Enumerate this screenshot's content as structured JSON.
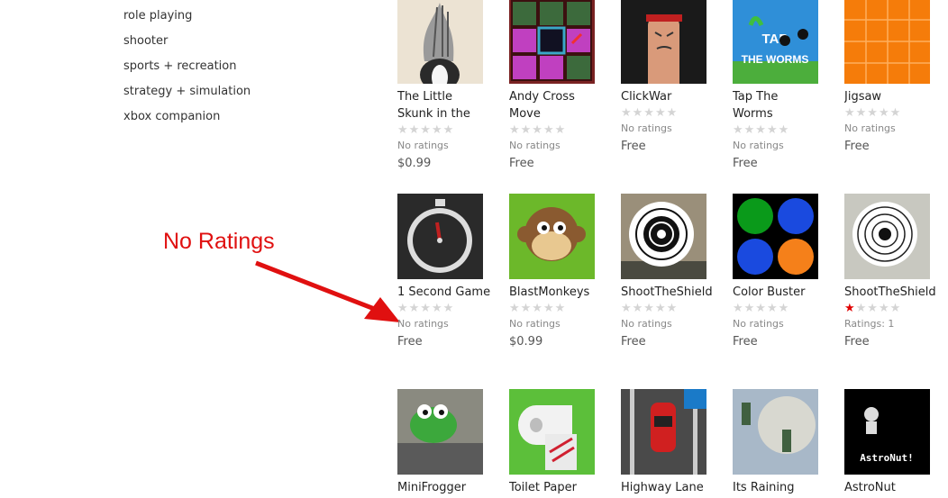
{
  "sidebar": {
    "items": [
      {
        "label": "role playing"
      },
      {
        "label": "shooter"
      },
      {
        "label": "sports + recreation"
      },
      {
        "label": "strategy + simulation"
      },
      {
        "label": "xbox companion"
      }
    ]
  },
  "annotation": {
    "text": "No Ratings"
  },
  "apps": [
    {
      "title": "The Little Skunk in the",
      "rating": 0,
      "ratings_text": "No ratings",
      "price": "$0.99",
      "icon": "skunk-icon"
    },
    {
      "title": "Andy Cross Move",
      "rating": 0,
      "ratings_text": "No ratings",
      "price": "Free",
      "icon": "monster-grid-icon"
    },
    {
      "title": "ClickWar",
      "rating": 0,
      "ratings_text": "No ratings",
      "price": "Free",
      "icon": "finger-ninja-icon"
    },
    {
      "title": "Tap The Worms",
      "rating": 0,
      "ratings_text": "No ratings",
      "price": "Free",
      "icon": "worms-icon"
    },
    {
      "title": "Jigsaw",
      "rating": 0,
      "ratings_text": "No ratings",
      "price": "Free",
      "icon": "jigsaw-icon"
    },
    {
      "title": "1 Second Game",
      "rating": 0,
      "ratings_text": "No ratings",
      "price": "Free",
      "icon": "stopwatch-icon"
    },
    {
      "title": "BlastMonkeys",
      "rating": 0,
      "ratings_text": "No ratings",
      "price": "$0.99",
      "icon": "monkey-icon"
    },
    {
      "title": "ShootTheShield",
      "rating": 0,
      "ratings_text": "No ratings",
      "price": "Free",
      "icon": "target-icon"
    },
    {
      "title": "Color Buster",
      "rating": 0,
      "ratings_text": "No ratings",
      "price": "Free",
      "icon": "color-dots-icon"
    },
    {
      "title": "ShootTheShield",
      "rating": 1,
      "ratings_text": "Ratings: 1",
      "price": "Free",
      "icon": "target-25-icon"
    },
    {
      "title": "MiniFrogger",
      "icon": "frog-icon"
    },
    {
      "title": "Toilet Paper",
      "icon": "toilet-paper-icon"
    },
    {
      "title": "Highway Lane",
      "icon": "car-lane-icon"
    },
    {
      "title": "Its Raining",
      "icon": "zombie-moon-icon"
    },
    {
      "title": "AstroNut",
      "icon": "astronaut-icon"
    }
  ]
}
